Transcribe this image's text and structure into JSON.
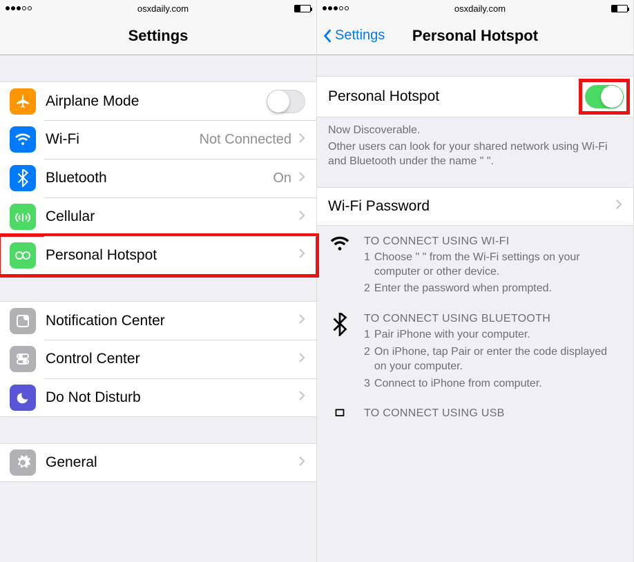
{
  "status_bar": {
    "carrier_dots_filled": 3,
    "carrier_dots_total": 5,
    "domain": "osxdaily.com",
    "battery_percent": 35
  },
  "left": {
    "title": "Settings",
    "items": [
      {
        "id": "airplane",
        "label": "Airplane Mode",
        "color": "#ff9500",
        "accessory": "toggle-off"
      },
      {
        "id": "wifi",
        "label": "Wi-Fi",
        "color": "#007aff",
        "detail": "Not Connected",
        "accessory": "chevron"
      },
      {
        "id": "bluetooth",
        "label": "Bluetooth",
        "color": "#007aff",
        "detail": "On",
        "accessory": "chevron"
      },
      {
        "id": "cellular",
        "label": "Cellular",
        "color": "#4cd964",
        "accessory": "chevron"
      },
      {
        "id": "hotspot",
        "label": "Personal Hotspot",
        "color": "#4cd964",
        "accessory": "chevron",
        "highlight": true
      }
    ],
    "items2": [
      {
        "id": "notif",
        "label": "Notification Center",
        "color": "#b0b0b5",
        "accessory": "chevron"
      },
      {
        "id": "control",
        "label": "Control Center",
        "color": "#b0b0b5",
        "accessory": "chevron"
      },
      {
        "id": "dnd",
        "label": "Do Not Disturb",
        "color": "#5856d6",
        "accessory": "chevron"
      }
    ],
    "items3": [
      {
        "id": "general",
        "label": "General",
        "color": "#b0b0b5",
        "accessory": "chevron"
      }
    ]
  },
  "right": {
    "back_label": "Settings",
    "title": "Personal Hotspot",
    "toggle_row": {
      "label": "Personal Hotspot",
      "on": true
    },
    "discover_title": "Now Discoverable.",
    "discover_body": "Other users can look for your shared network using Wi-Fi and Bluetooth under the name \"                        \".",
    "wifi_password_label": "Wi-Fi Password",
    "instructions": {
      "wifi": {
        "title": "TO CONNECT USING WI-FI",
        "steps": [
          "Choose \"                        \" from the Wi-Fi settings on your computer or other device.",
          "Enter the password when prompted."
        ]
      },
      "bluetooth": {
        "title": "TO CONNECT USING BLUETOOTH",
        "steps": [
          "Pair iPhone with your computer.",
          "On iPhone, tap Pair or enter the code displayed on your computer.",
          "Connect to iPhone from computer."
        ]
      },
      "usb": {
        "title": "TO CONNECT USING USB"
      }
    }
  }
}
